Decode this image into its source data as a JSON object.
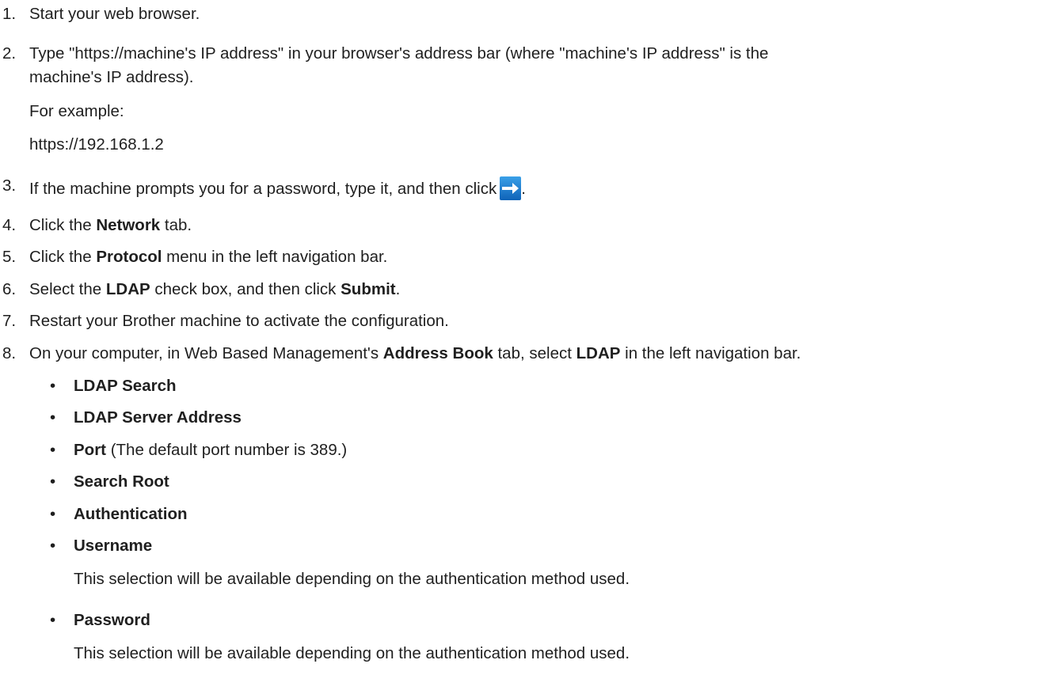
{
  "steps": [
    {
      "n": "1.",
      "parts": [
        "Start your web browser."
      ]
    },
    {
      "n": "2.",
      "line1": "Type \"https://machine's IP address\" in your browser's address bar (where \"machine's IP address\" is the",
      "line2": "machine's IP address)."
    },
    {
      "example_label": "For example:",
      "example_value": "https://192.168.1.2"
    },
    {
      "n": "3.",
      "text": "If the machine prompts you for a password, type it, and then click",
      "end": "."
    },
    {
      "n": "4.",
      "a": "Click the ",
      "b": "Network",
      "c": " tab."
    },
    {
      "n": "5.",
      "a": "Click the ",
      "b": "Protocol",
      "c": " menu in the left navigation bar."
    },
    {
      "n": "6.",
      "a": "Select the ",
      "b": "LDAP",
      "c": " check box, and then click ",
      "d": "Submit",
      "e": "."
    },
    {
      "n": "7.",
      "text": "Restart your Brother machine to activate the configuration."
    },
    {
      "n": "8.",
      "a": "On your computer, in Web Based Management's ",
      "b": "Address Book",
      "c": " tab, select ",
      "d": "LDAP",
      "e": " in the left navigation bar."
    }
  ],
  "bullets": [
    {
      "label": "LDAP Search"
    },
    {
      "label": "LDAP Server Address"
    },
    {
      "label": "Port",
      "note": " (The default port number is 389.)"
    },
    {
      "label": "Search Root"
    },
    {
      "label": "Authentication"
    },
    {
      "label": "Username",
      "detail": "This selection will be available depending on the authentication method used."
    },
    {
      "label": "Password",
      "detail": "This selection will be available depending on the authentication method used."
    }
  ],
  "bullet_char": "•",
  "icons": {
    "submit_arrow": "right-arrow-icon"
  },
  "colors": {
    "arrow_button": "#1a78cf",
    "text": "#1f1f1f"
  }
}
